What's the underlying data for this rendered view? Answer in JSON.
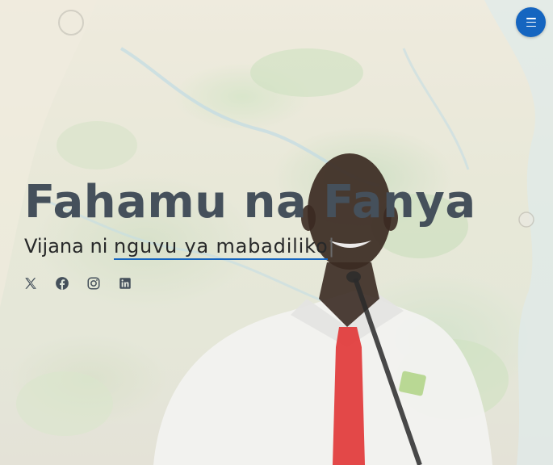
{
  "hero": {
    "title": "Fahamu na Fanya",
    "subtitle_prefix": "Vijana ni ",
    "typed_text": "nguvu ya mabadiliko",
    "cursor": "|"
  },
  "nav": {
    "menu_icon": "hamburger-menu-icon",
    "accent_color": "#1565c0"
  },
  "socials": [
    {
      "name": "x-twitter",
      "icon": "x-icon"
    },
    {
      "name": "facebook",
      "icon": "facebook-icon"
    },
    {
      "name": "instagram",
      "icon": "instagram-icon"
    },
    {
      "name": "linkedin",
      "icon": "linkedin-icon"
    }
  ],
  "colors": {
    "title": "#45505b",
    "subtitle": "#272829",
    "icons": "#45505b"
  }
}
